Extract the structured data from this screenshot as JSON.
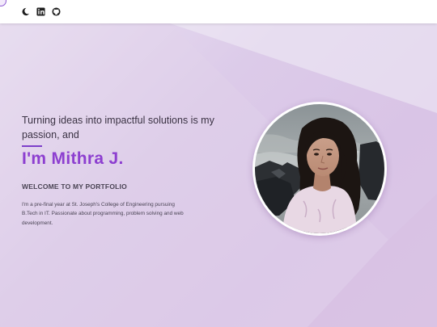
{
  "header": {
    "icons": [
      "moon-icon",
      "linkedin-icon",
      "github-icon"
    ]
  },
  "hero": {
    "tagline": "Turning ideas into impactful solutions is my passion, and",
    "name": "I'm Mithra J.",
    "welcome": "WELCOME TO MY PORTFOLIO",
    "bio": "I'm a pre-final year at St. Joseph's College of Engineering pursuing B.Tech in IT. Passionate about programming, problem solving and web development."
  },
  "colors": {
    "accent": "#8d3fd0",
    "background": "#dccbe9",
    "text": "#3b3344"
  }
}
